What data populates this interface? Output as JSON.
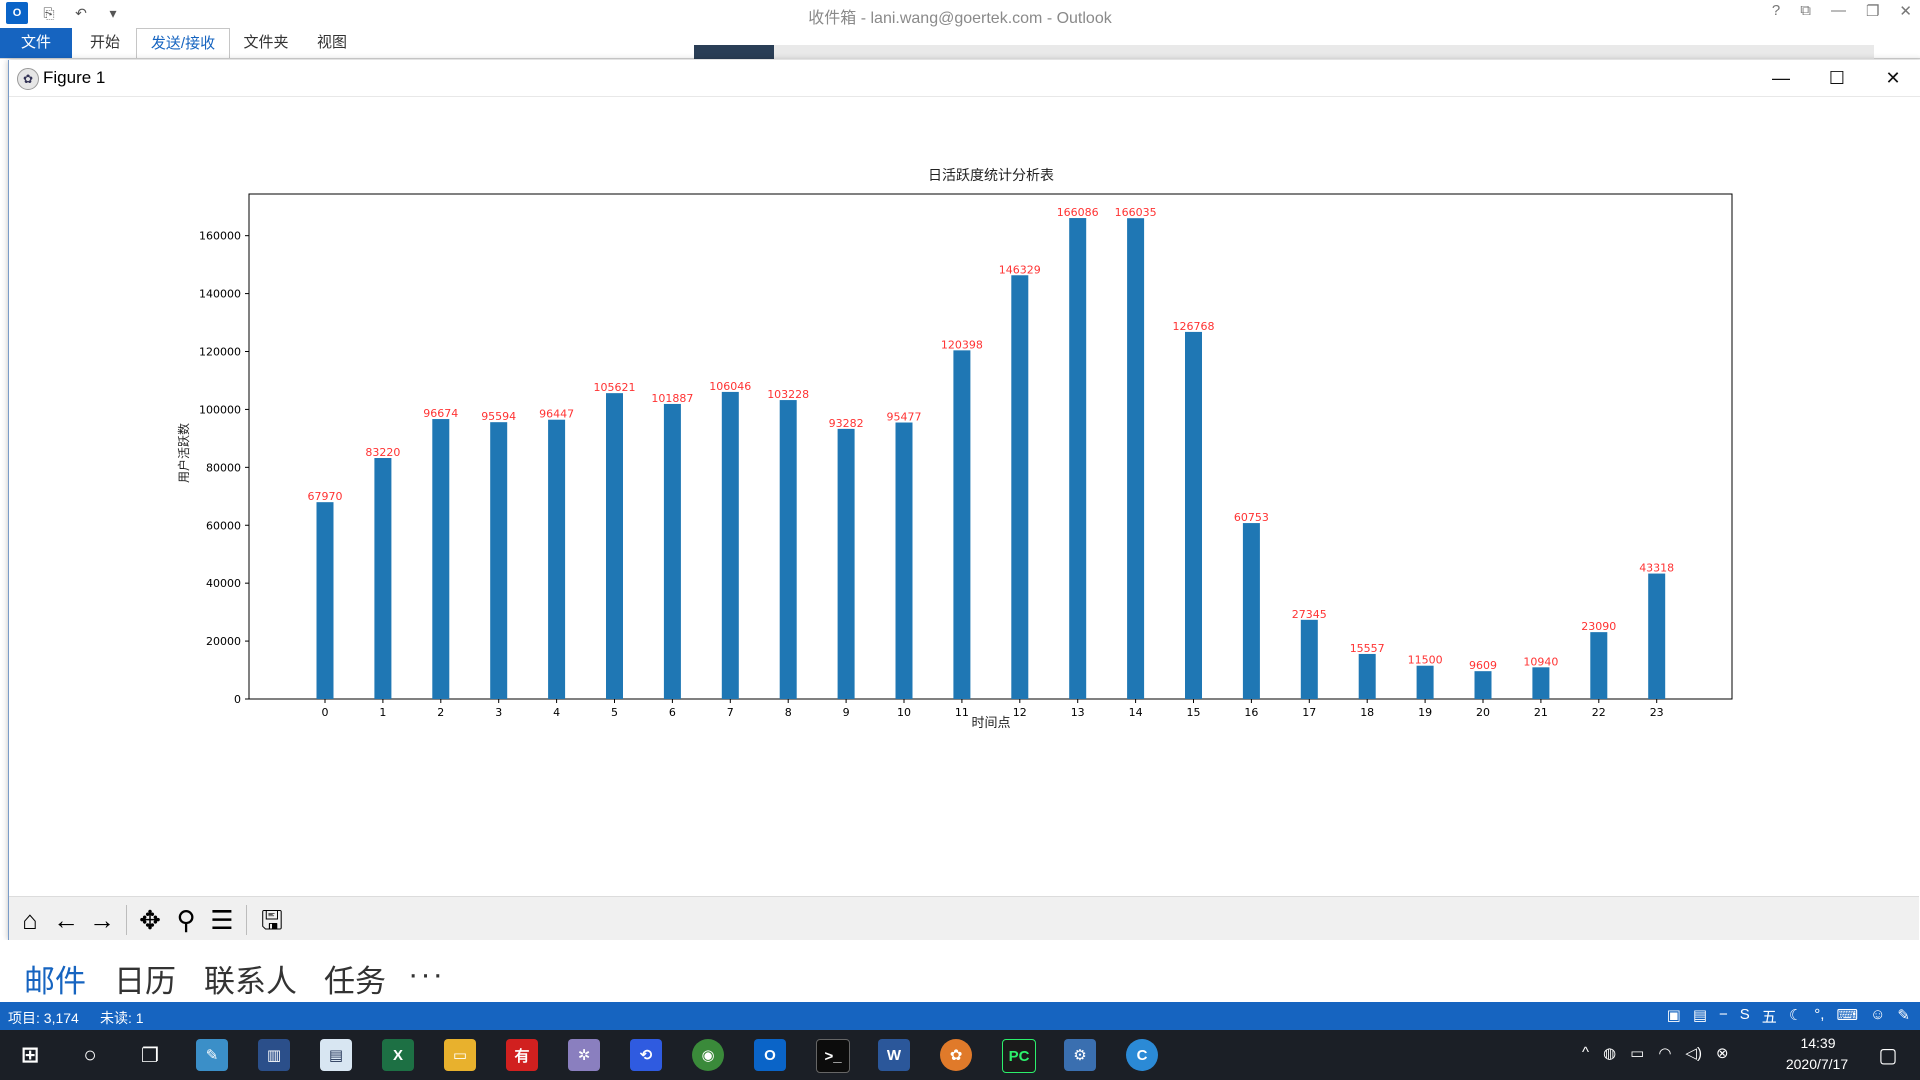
{
  "outlook": {
    "window_title": "收件箱 - lani.wang@goertek.com - Outlook",
    "ribbon_tabs": [
      "文件",
      "开始",
      "发送/接收",
      "文件夹",
      "视图"
    ],
    "nav": [
      "邮件",
      "日历",
      "联系人",
      "任务",
      "···"
    ],
    "status": {
      "items": "项目: 3,174",
      "unread": "未读: 1"
    }
  },
  "figure": {
    "title": "Figure 1"
  },
  "chart_data": {
    "type": "bar",
    "title": "日活跃度统计分析表",
    "xlabel": "时间点",
    "ylabel": "用户活跃数",
    "categories": [
      "0",
      "1",
      "2",
      "3",
      "4",
      "5",
      "6",
      "7",
      "8",
      "9",
      "10",
      "11",
      "12",
      "13",
      "14",
      "15",
      "16",
      "17",
      "18",
      "19",
      "20",
      "21",
      "22",
      "23"
    ],
    "values": [
      67970,
      83220,
      96674,
      95594,
      96447,
      105621,
      101887,
      106046,
      103228,
      93282,
      95477,
      120398,
      146329,
      166086,
      166035,
      126768,
      60753,
      27345,
      15557,
      11500,
      9609,
      10940,
      23090,
      43318
    ],
    "yticks": [
      0,
      20000,
      40000,
      60000,
      80000,
      100000,
      120000,
      140000,
      160000
    ],
    "ylim": [
      0,
      174390
    ],
    "bar_color": "#1f77b4",
    "label_color": "#ff3333",
    "grid": false
  },
  "taskbar": {
    "time": "14:39",
    "date": "2020/7/17"
  },
  "colors": {
    "outlook_blue": "#1664c0",
    "taskbar": "#1b1f26"
  }
}
